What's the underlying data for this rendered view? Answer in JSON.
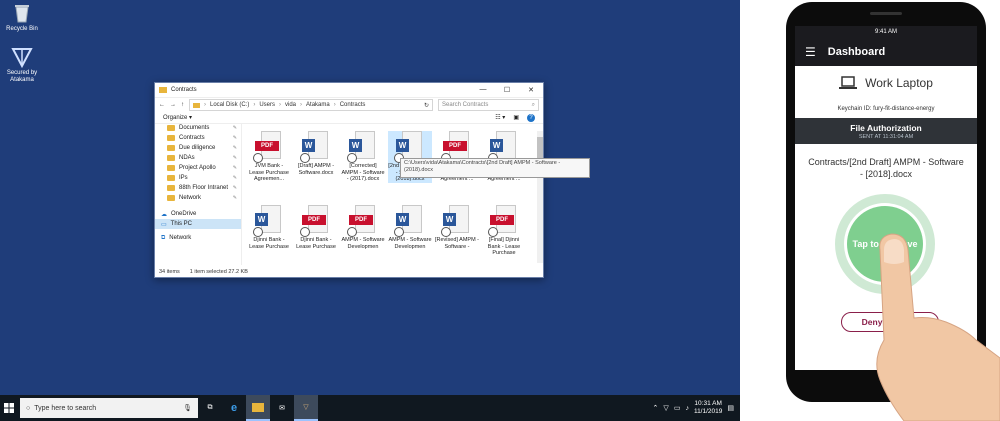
{
  "desktop": {
    "icons": [
      {
        "label": "Recycle Bin"
      },
      {
        "label": "Secured by Atakama"
      }
    ]
  },
  "explorer": {
    "title": "Contracts",
    "path": [
      "Local Disk (C:)",
      "Users",
      "vida",
      "Atakama",
      "Contracts"
    ],
    "search_placeholder": "Search Contracts",
    "organize_label": "Organize ▾",
    "nav_items": [
      {
        "label": "Documents"
      },
      {
        "label": "Contracts"
      },
      {
        "label": "Due diligence"
      },
      {
        "label": "NDAs"
      },
      {
        "label": "Project Apollo"
      },
      {
        "label": "IPs"
      },
      {
        "label": "88th Floor Intranet"
      },
      {
        "label": "Network"
      }
    ],
    "nav_onedrive": "OneDrive",
    "nav_thispc": "This PC",
    "nav_network": "Network",
    "files_row1": [
      {
        "name": "JVM Bank - Lease Purchase Agreemen...",
        "type": "pdf"
      },
      {
        "name": "[Draft] AMPM - Software.docx",
        "type": "word"
      },
      {
        "name": "[Corrected] AMPM - Software - (2017).docx",
        "type": "word"
      },
      {
        "name": "[2nd Draft] AMPM - Software - (2018).docx",
        "type": "word"
      },
      {
        "name": "JVM Bank - Lease Purchase Agreement ...",
        "type": "pdf"
      },
      {
        "name": "JVM Bank - Lease Purchase Agreement ...",
        "type": "word"
      }
    ],
    "files_row2": [
      {
        "name": "Djinni Bank - Lease Purchase",
        "type": "word"
      },
      {
        "name": "Djinni Bank - Lease Purchase",
        "type": "pdf"
      },
      {
        "name": "AMPM - Software Developmen",
        "type": "pdf"
      },
      {
        "name": "AMPM - Software Developmen",
        "type": "word"
      },
      {
        "name": "[Revised] AMPM - Software -",
        "type": "word"
      },
      {
        "name": "[Final] Djinni Bank - Lease Purchase",
        "type": "pdf"
      }
    ],
    "tooltip": "C:\\Users\\vida\\Atakama\\Contracts\\[2nd Draft] AMPM - Software - (2018).docx",
    "status_count": "34 items",
    "status_selected": "1 item selected  27.2 KB"
  },
  "taskbar": {
    "search_placeholder": "Type here to search",
    "time": "10:31 AM",
    "date": "11/1/2019"
  },
  "phone": {
    "status_time": "9:41 AM",
    "header_title": "Dashboard",
    "device_name": "Work Laptop",
    "keychain": "Keychain ID: fury-fit-distance-energy",
    "auth_title": "File Authorization",
    "auth_sent": "SENT AT 11:31:04 AM",
    "doc_name": "Contracts/[2nd Draft] AMPM - Software - [2018].docx",
    "approve_label": "Tap to Approve",
    "deny_label": "Deny Request"
  },
  "colors": {
    "desktop_bg": "#1f3d7a",
    "approve_green": "#7fcf8f",
    "deny_maroon": "#8a1f4a",
    "pdf_red": "#c8102e",
    "word_blue": "#2b579a"
  }
}
